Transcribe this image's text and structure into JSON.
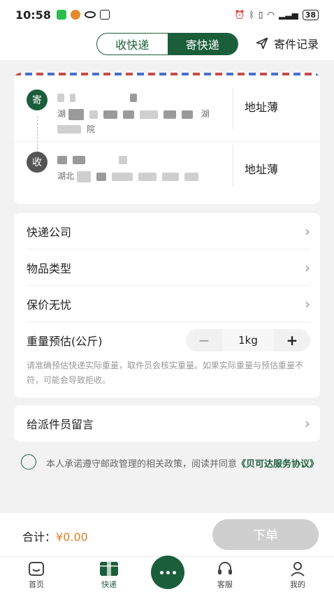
{
  "status": {
    "time": "10:58",
    "battery": "38"
  },
  "header": {
    "tabs": [
      {
        "label": "收快递",
        "active": false
      },
      {
        "label": "寄快递",
        "active": true
      }
    ],
    "record_label": "寄件记录"
  },
  "address": {
    "sender": {
      "badge": "寄",
      "line1_prefix": "",
      "line2_prefix": "湖",
      "line2_suffix": "湖",
      "line3": "院",
      "book_label": "地址薄"
    },
    "receiver": {
      "badge": "收",
      "line1_prefix": "",
      "line2_prefix": "湖北",
      "book_label": "地址薄"
    }
  },
  "options": {
    "courier": "快递公司",
    "item_type": "物品类型",
    "insurance": "保价无忧",
    "weight_label": "重量预估(公斤)",
    "weight_value": "1kg",
    "minus": "−",
    "plus": "+",
    "weight_note": "请准确预估快递实际重量，取件员会核实重量。如果实际重量与预估重量不符，可能会导致拒收。",
    "message": "给派件员留言"
  },
  "agreement": {
    "text": "本人承诺遵守邮政管理的相关政策，阅读并同意",
    "link": "《贝可达服务协议》"
  },
  "order": {
    "total_label": "合计：",
    "total_value": "¥0.00",
    "submit_label": "下单"
  },
  "tabbar": {
    "items": [
      {
        "label": "首页"
      },
      {
        "label": "快递"
      },
      {
        "label": "客服"
      },
      {
        "label": "我的"
      }
    ]
  },
  "colors": {
    "brand": "#1b5e3b",
    "price": "#d9822b",
    "disabled": "#cfcfcf"
  }
}
